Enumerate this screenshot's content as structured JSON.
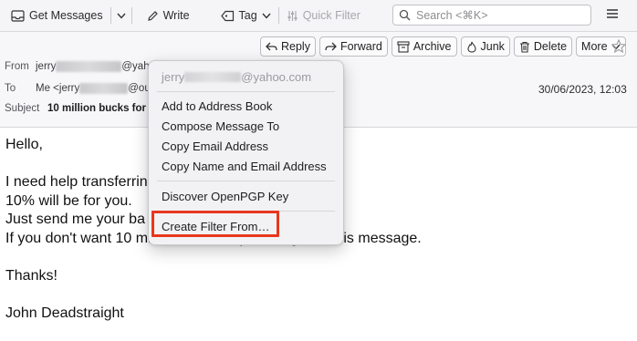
{
  "toolbar": {
    "get_messages": "Get Messages",
    "write": "Write",
    "tag": "Tag",
    "quick_filter": "Quick Filter",
    "search_placeholder": "Search <⌘K>"
  },
  "actions": {
    "reply": "Reply",
    "forward": "Forward",
    "archive": "Archive",
    "junk": "Junk",
    "delete": "Delete",
    "more": "More"
  },
  "header": {
    "from_label": "From",
    "from_prefix": "jerry",
    "from_domain": "@yahoo.c",
    "to_label": "To",
    "to_prefix": "Me <jerry",
    "to_domain": "@outlo",
    "date": "30/06/2023, 12:03",
    "subject_label": "Subject",
    "subject": "10 million bucks for"
  },
  "body": {
    "lines": [
      "Hello,",
      "",
      "I need help transferrin",
      "10% will be for you.",
      "Just send me your ba                                 help.",
      "If you don't want 10 millions dollars, please ignore this message.",
      "",
      "Thanks!",
      "",
      "John Deadstraight"
    ]
  },
  "context_menu": {
    "header_prefix": "jerry",
    "header_domain": "@yahoo.com",
    "items": [
      "Add to Address Book",
      "Compose Message To",
      "Copy Email Address",
      "Copy Name and Email Address",
      "Discover OpenPGP Key",
      "Create Filter From…"
    ]
  },
  "colors": {
    "highlight": "#e8371f",
    "toolbar_bg": "#f5f5f7",
    "menu_bg": "#f2f2f4"
  }
}
